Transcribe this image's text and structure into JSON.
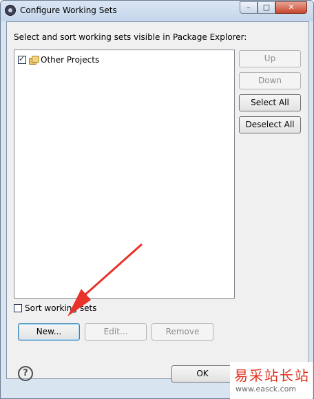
{
  "window": {
    "title": "Configure Working Sets",
    "minimize_glyph": "–",
    "maximize_glyph": "□",
    "close_glyph": "✕"
  },
  "description": "Select and sort working sets visible in Package Explorer:",
  "working_sets": [
    {
      "label": "Other Projects",
      "checked": true,
      "icon": "working-set-icon"
    }
  ],
  "side_buttons": {
    "up": "Up",
    "down": "Down",
    "select_all": "Select All",
    "deselect_all": "Deselect All"
  },
  "sort": {
    "label": "Sort working sets",
    "checked": false
  },
  "bottom_buttons": {
    "new": "New...",
    "edit": "Edit...",
    "remove": "Remove"
  },
  "help_glyph": "?",
  "ok_label": "OK",
  "annotation": {
    "color": "#e8322a"
  },
  "watermark": {
    "text": "易采站长站",
    "url": "www.easck.com"
  }
}
